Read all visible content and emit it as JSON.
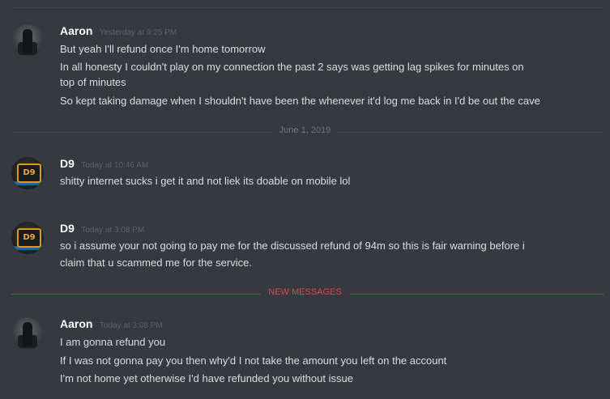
{
  "messages": [
    {
      "author": "Aaron",
      "timestamp": "Yesterday at 9:25 PM",
      "avatar_icon": "aaron-avatar",
      "lines": [
        "But yeah I'll refund once I'm home tomorrow",
        "In all honesty I couldn't play on my connection the past 2 says was getting lag spikes for minutes on",
        "top of minutes",
        "So kept taking damage when I shouldn't have been the whenever it'd log me back in I'd be out the cave"
      ]
    },
    {
      "author": "D9",
      "timestamp": "Today at 10:46 AM",
      "avatar_icon": "d9-avatar",
      "lines": [
        "shitty internet sucks i get it and not liek its doable on mobile lol"
      ]
    },
    {
      "author": "D9",
      "timestamp": "Today at 3:08 PM",
      "avatar_icon": "d9-avatar",
      "lines": [
        "so i assume your not going to pay me for the discussed refund of 94m so this is fair warning before i",
        "claim that u scammed me for the service."
      ]
    },
    {
      "author": "Aaron",
      "timestamp": "Today at 3:08 PM",
      "avatar_icon": "aaron-avatar",
      "lines": [
        "I am gonna refund you",
        "If I was not gonna pay you then why'd I not take the amount you left on the account",
        "I'm not home yet otherwise I'd have refunded you without issue"
      ]
    }
  ],
  "dividers": {
    "date": "June 1, 2019",
    "new_messages": "NEW MESSAGES"
  },
  "avatar_badge": "D9",
  "colors": {
    "background": "#36393f",
    "username": "#ffffff",
    "message_text": "#dcddde",
    "timestamp": "#5e6166",
    "new_messages": "#d84a4a"
  }
}
